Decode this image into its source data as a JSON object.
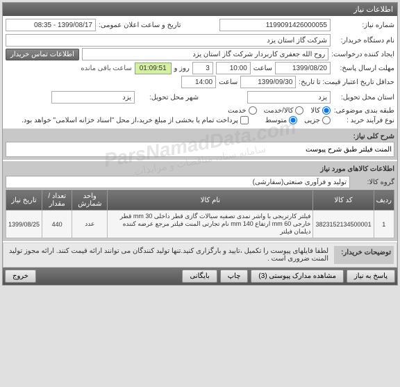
{
  "header": {
    "title": "اطلاعات نیاز"
  },
  "fields": {
    "need_number_label": "شماره نیاز:",
    "need_number": "1199091426000055",
    "announce_label": "تاریخ و ساعت اعلان عمومی:",
    "announce_value": "1399/08/17 - 08:35",
    "buyer_label": "نام دستگاه خریدار:",
    "buyer_value": "شرکت گاز استان یزد",
    "creator_label": "ایجاد کننده درخواست:",
    "creator_value": "روح الله جعفری کاربردار  شرکت گاز استان یزد",
    "contact_btn": "اطلاعات تماس خریدار",
    "deadline_send_label": "مهلت ارسال پاسخ:",
    "deadline_send_date": "1399/08/20",
    "time_label": "ساعت",
    "deadline_send_time": "10:00",
    "days": "3",
    "days_label": "روز و",
    "countdown": "01:09:51",
    "remaining": "ساعت باقی مانده",
    "validity_label": "حداقل تاریخ اعتبار قیمت: تا تاریخ:",
    "validity_date": "1399/09/30",
    "validity_time": "14:00",
    "delivery_province_label": "استان محل تحویل:",
    "delivery_province": "یزد",
    "delivery_city_label": "شهر محل تحویل:",
    "delivery_city": "یزد",
    "category_label": "طبقه بندی موضوعی:",
    "cat_all": "کالا",
    "cat_service": "کالا/خدمت",
    "cat_only": "خدمت",
    "purchase_type_label": "نوع فرآیند خرید :",
    "pt_small": "جزیی",
    "pt_medium": "متوسط",
    "payment_note": "پرداخت تمام یا بخشی از مبلغ خرید،از محل \"اسناد خزانه اسلامی\" خواهد بود."
  },
  "need_desc": {
    "title": "شرح کلی نیاز:",
    "value": "المنت فیلتر طبق شرح پیوست"
  },
  "goods_info": {
    "title": "اطلاعات کالاهای مورد نیاز",
    "group_label": "گروه کالا:",
    "group_value": "تولید و فرآوری صنعتی(سفارشی)"
  },
  "table": {
    "headers": {
      "row": "ردیف",
      "code": "کد کالا",
      "name": "نام کالا",
      "unit": "واحد شمارش",
      "qty": "تعداد / مقدار",
      "date": "تاریخ نیاز"
    },
    "rows": [
      {
        "row": "1",
        "code": "3823152134500001",
        "name": "فیلتر کارتریجی با واشر نمدی تصفیه سیالات گازی قطر داخلی mm 30 قطر خارجی mm 60 ارتفاع mm 140 نام تجارتی المنت فیلتر مرجع عرضه کننده دیلمان فیلتر",
        "unit": "عدد",
        "qty": "440",
        "date": "1399/08/25"
      }
    ]
  },
  "buyer_notes": {
    "label": "توضیحات خریدار:",
    "content": "لطفا فایلهای پیوست را تکمیل ،تایید و بارگزاری کنید.تنها  تولید کنندگان می توانند ارائه قیمت کنند. ارائه مجوز تولید المنت ضروری است ."
  },
  "footer": {
    "exit": "خروج",
    "save": "بایگانی",
    "print": "چاپ",
    "attachments": "مشاهده مدارک پیوستی (3)",
    "respond": "پاسخ به نیاز"
  },
  "watermark": {
    "main": "ParsNamadData.com",
    "sub": "سامانه ستاد، مناقصات و مزایدات"
  }
}
